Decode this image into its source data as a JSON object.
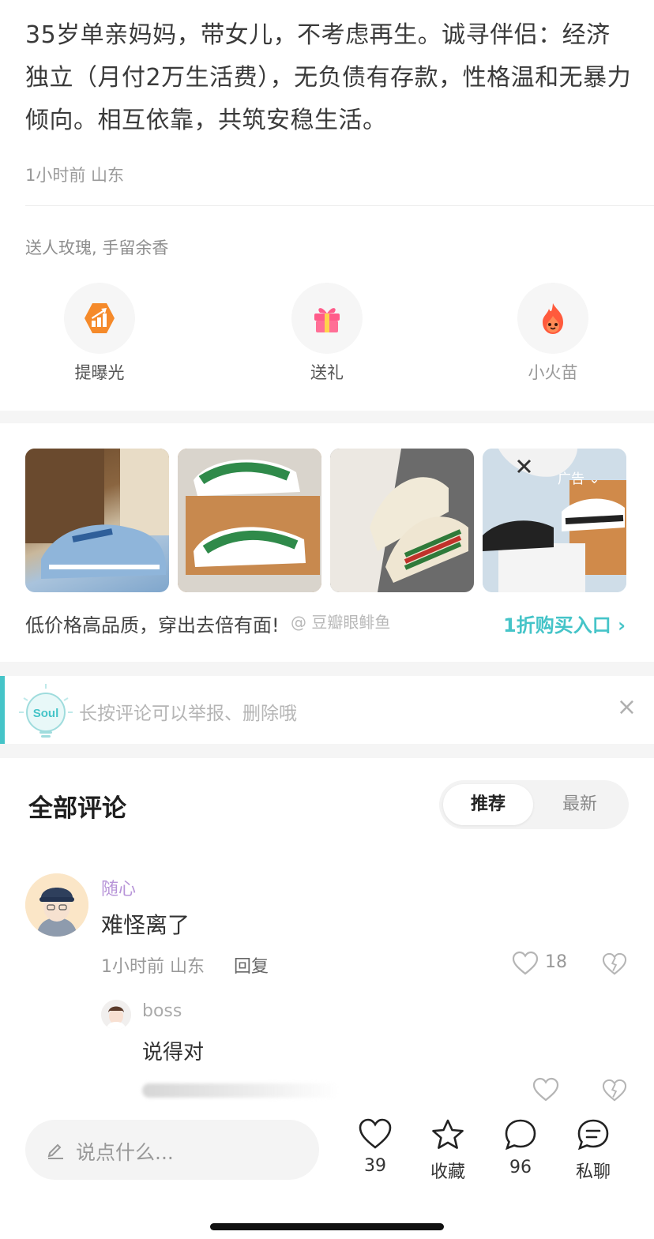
{
  "post": {
    "text": "35岁单亲妈妈，带女儿，不考虑再生。诚寻伴侣：经济独立（月付2万生活费），无负债有存款，性格温和无暴力倾向。相互依靠，共筑安稳生活。",
    "meta": "1小时前 山东"
  },
  "gifts": {
    "hint": "送人玫瑰, 手留余香",
    "actions": [
      {
        "label": "提曝光",
        "icon": "boost-icon"
      },
      {
        "label": "送礼",
        "icon": "gift-icon"
      },
      {
        "label": "小火苗",
        "icon": "flame-icon"
      }
    ]
  },
  "ad": {
    "tag": "广告",
    "caption": "低价格高品质，穿出去倍有面!",
    "watermark": "@ 豆瓣眼鲱鱼",
    "cta": "1折购买入口 ›",
    "images": [
      "sneaker-lv-denim",
      "sneaker-lv-green",
      "sneaker-gucci",
      "sneaker-nike-box"
    ]
  },
  "tip": {
    "logo": "Soul",
    "text": "长按评论可以举报、删除哦",
    "close": "×"
  },
  "comments": {
    "title": "全部评论",
    "sort": [
      "推荐",
      "最新"
    ],
    "items": [
      {
        "name": "随心",
        "text": "难怪离了",
        "meta": "1小时前 山东",
        "reply": "回复",
        "likes": "18"
      },
      {
        "name": "boss",
        "text": "说得对"
      }
    ]
  },
  "bottom": {
    "placeholder": "说点什么...",
    "like_count": "39",
    "favorite_label": "收藏",
    "comment_count": "96",
    "chat_label": "私聊"
  },
  "colors": {
    "accent": "#45c4c8",
    "name_purple": "#b794d8"
  }
}
